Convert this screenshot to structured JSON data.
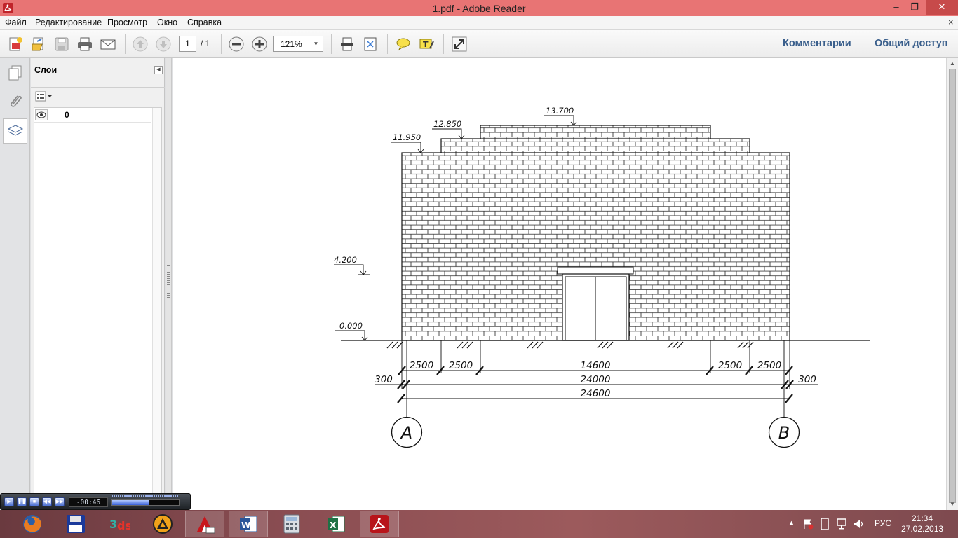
{
  "window": {
    "title": "1.pdf - Adobe Reader",
    "controls": {
      "minimize": "‒",
      "restore": "❐",
      "close": "✕"
    }
  },
  "menu": {
    "items": [
      "Файл",
      "Редактирование",
      "Просмотр",
      "Окно",
      "Справка"
    ],
    "close_doc": "×"
  },
  "toolbar": {
    "page_current": "1",
    "page_total": "/ 1",
    "zoom": "121%",
    "comments_link": "Комментарии",
    "share_link": "Общий доступ"
  },
  "layers_panel": {
    "title": "Слои",
    "layers": [
      {
        "name": "0",
        "visible": true
      }
    ]
  },
  "drawing": {
    "levels": {
      "top": "13.700",
      "mid": "12.850",
      "eave": "11.950",
      "door": "4.200",
      "ground": "0.000"
    },
    "dims_row1": [
      "2500",
      "2500",
      "14600",
      "2500",
      "2500"
    ],
    "dims_row2": {
      "left": "300",
      "total": "24000",
      "right": "300"
    },
    "dims_row3": "24600",
    "axes": [
      "A",
      "B"
    ]
  },
  "player": {
    "time": "-00:46",
    "progress": 0.55
  },
  "taskbar": {
    "apps": [
      "firefox-icon",
      "save-disk-icon",
      "3ds-max-icon",
      "archicad-icon",
      "autocad-icon",
      "word-icon",
      "calculator-icon",
      "excel-icon",
      "adobe-reader-icon"
    ],
    "language": "РУС",
    "time": "21:34",
    "date": "27.02.2013"
  },
  "colors": {
    "titlebar": "#e87474",
    "link": "#3a5f8c",
    "taskbar": "#8a4d52"
  }
}
